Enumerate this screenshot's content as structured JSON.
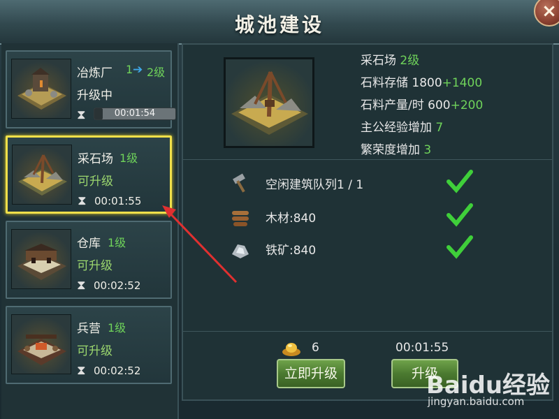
{
  "window": {
    "title": "城池建设",
    "close_label": "×"
  },
  "buildings": [
    {
      "name": "冶炼厂",
      "level_from": "1",
      "level_to": "2级",
      "status": "升级中",
      "time": "00:01:54",
      "progress": 0.1,
      "upgrading": true,
      "selected": false
    },
    {
      "name": "采石场",
      "level": "1级",
      "status": "可升级",
      "time": "00:01:55",
      "upgrading": false,
      "selected": true
    },
    {
      "name": "仓库",
      "level": "1级",
      "status": "可升级",
      "time": "00:02:52",
      "upgrading": false,
      "selected": false
    },
    {
      "name": "兵营",
      "level": "1级",
      "status": "可升级",
      "time": "00:02:52",
      "upgrading": false,
      "selected": false
    }
  ],
  "detail": {
    "name": "采石场",
    "level": "2级",
    "stats": [
      {
        "label": "石料存储",
        "base": "1800",
        "bonus": "+1400"
      },
      {
        "label": "石料产量/时",
        "base": "600",
        "bonus": "+200"
      },
      {
        "label": "主公经验增加",
        "base": "",
        "bonus": "7"
      },
      {
        "label": "繁荣度增加",
        "base": "",
        "bonus": "3"
      }
    ],
    "requirements": [
      {
        "icon": "hammer-icon",
        "text": "空闲建筑队列1 / 1",
        "met": true
      },
      {
        "icon": "wood-icon",
        "text": "木材:840",
        "met": true
      },
      {
        "icon": "iron-ore-icon",
        "text": "铁矿:840",
        "met": true
      }
    ],
    "instant_cost": "6",
    "upgrade_time": "00:01:55",
    "instant_button": "立即升级",
    "upgrade_button": "升级"
  },
  "watermark": {
    "logo": "Baidu经验",
    "url": "jingyan.baidu.com"
  },
  "colors": {
    "accent_green": "#6fd35a",
    "highlight_yellow": "#f0e04a",
    "arrow_red": "#e03030"
  }
}
